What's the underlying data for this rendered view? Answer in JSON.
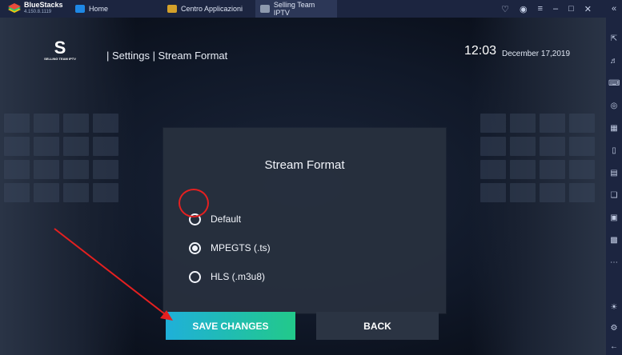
{
  "emulator": {
    "brand": "BlueStacks",
    "version": "4.150.8.1119",
    "tabs": [
      {
        "label": "Home"
      },
      {
        "label": "Centro Applicazioni"
      },
      {
        "label": "Selling Team IPTV"
      }
    ],
    "colors": {
      "titlebar": "#1c2540",
      "active_tab": "#2c3757"
    }
  },
  "app": {
    "logo_text": "SELLING TEAM IPTV",
    "breadcrumb": "| Settings | Stream Format",
    "time": "12:03",
    "date": "December 17,2019"
  },
  "dialog": {
    "title": "Stream Format",
    "options": [
      {
        "label": "Default",
        "selected": false
      },
      {
        "label": "MPEGTS (.ts)",
        "selected": true
      },
      {
        "label": "HLS (.m3u8)",
        "selected": false
      }
    ],
    "save_label": "SAVE CHANGES",
    "back_label": "BACK",
    "colors": {
      "save_start": "#1fb0d9",
      "save_end": "#22c98a",
      "annotation": "#e52020"
    }
  }
}
